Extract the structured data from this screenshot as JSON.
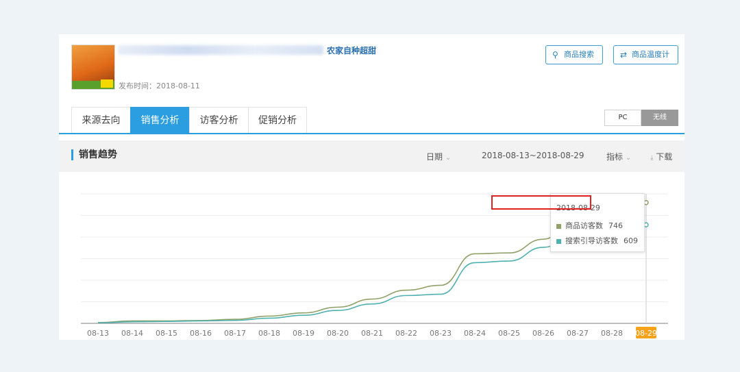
{
  "product": {
    "title_visible": "农家自种超甜",
    "publish_label": "发布时间：2018-08-11"
  },
  "buttons": {
    "search_label": "商品搜索",
    "temp_label": "商品温度计"
  },
  "tabs": [
    {
      "label": "来源去向",
      "active": false
    },
    {
      "label": "销售分析",
      "active": true
    },
    {
      "label": "访客分析",
      "active": false
    },
    {
      "label": "促销分析",
      "active": false
    }
  ],
  "device": {
    "pc": "PC",
    "wireless": "无线",
    "selected": "无线"
  },
  "section": {
    "title": "销售趋势",
    "date_label": "日期",
    "range": "2018-08-13~2018-08-29",
    "metric_label": "指标",
    "download_label": "下载"
  },
  "tooltip": {
    "date": "2018-08-29",
    "rows": [
      {
        "label": "商品访客数",
        "value": "746"
      },
      {
        "label": "搜索引导访客数",
        "value": "609"
      }
    ]
  },
  "colors": {
    "accent": "#2a9ee0",
    "series1": "#8fa068",
    "series2": "#4fb0b0",
    "highlight_x": "#f7a21b",
    "highlight_box": "#e0201f"
  },
  "chart_data": {
    "type": "line",
    "title": "",
    "xlabel": "",
    "ylabel": "",
    "categories": [
      "08-13",
      "08-14",
      "08-15",
      "08-16",
      "08-17",
      "08-18",
      "08-19",
      "08-20",
      "08-21",
      "08-22",
      "08-23",
      "08-24",
      "08-25",
      "08-26",
      "08-27",
      "08-28",
      "08-29"
    ],
    "ylim": [
      0,
      800
    ],
    "grid": true,
    "highlight_category": "08-29",
    "series": [
      {
        "name": "商品访客数",
        "values": [
          5,
          15,
          15,
          18,
          25,
          45,
          65,
          100,
          150,
          205,
          235,
          430,
          435,
          520,
          670,
          720,
          746
        ]
      },
      {
        "name": "搜索引导访客数",
        "values": [
          3,
          10,
          12,
          15,
          18,
          32,
          50,
          80,
          120,
          172,
          180,
          375,
          385,
          470,
          565,
          595,
          609
        ]
      }
    ]
  }
}
